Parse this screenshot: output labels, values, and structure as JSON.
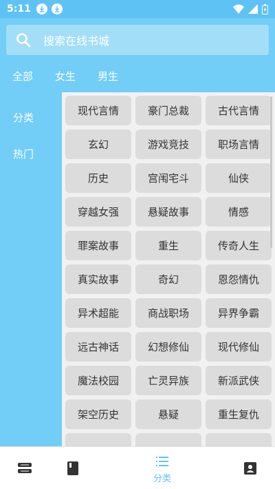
{
  "status": {
    "time": "5:11"
  },
  "search": {
    "placeholder": "搜索在线书城"
  },
  "top_tabs": [
    "全部",
    "女生",
    "男生"
  ],
  "sidebar": {
    "items": [
      "分类",
      "热门"
    ]
  },
  "categories": [
    "现代言情",
    "豪门总裁",
    "古代言情",
    "玄幻",
    "游戏竞技",
    "职场言情",
    "历史",
    "宫闱宅斗",
    "仙侠",
    "穿越女强",
    "悬疑故事",
    "情感",
    "罪案故事",
    "重生",
    "传奇人生",
    "真实故事",
    "奇幻",
    "恩怨情仇",
    "异术超能",
    "商战职场",
    "异界争霸",
    "远古神话",
    "幻想修仙",
    "现代修仙",
    "魔法校园",
    "亡灵异族",
    "新派武侠",
    "架空历史",
    "悬疑",
    "重生复仇"
  ],
  "bottom_nav": {
    "active_label": "分类"
  },
  "colors": {
    "accent": "#72cdf7",
    "status_bar": "#5fc2f4",
    "chip": "#dcdcdc"
  },
  "icons": [
    "download-icon",
    "wifi-icon",
    "signal-icon",
    "battery-icon",
    "search-icon",
    "bookshelf-icon",
    "book-icon",
    "list-icon",
    "contact-icon"
  ]
}
